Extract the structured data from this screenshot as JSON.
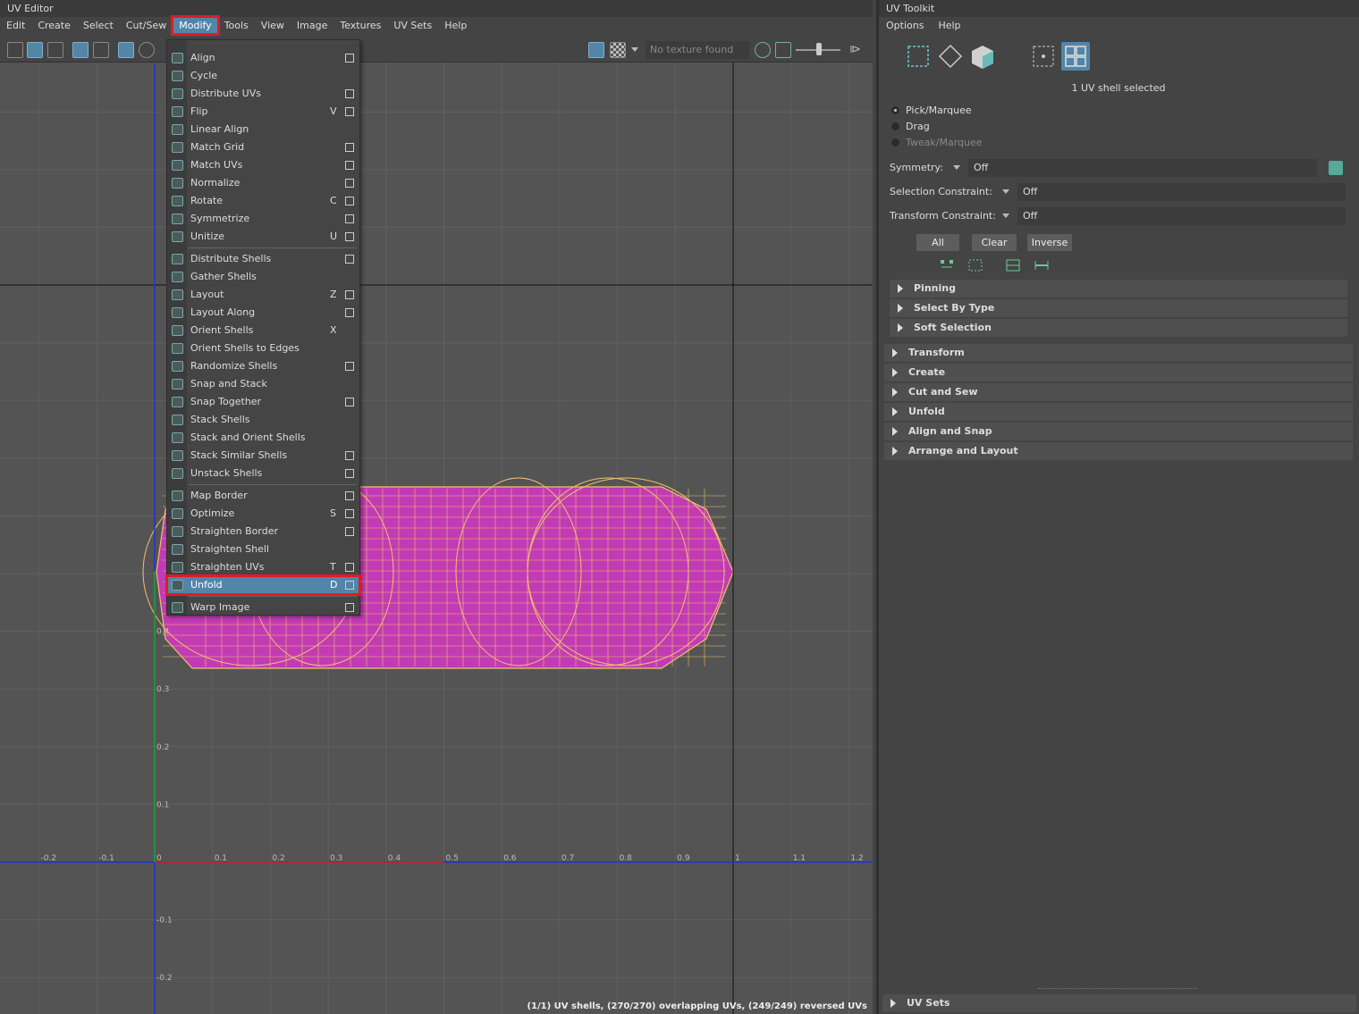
{
  "editor": {
    "title": "UV Editor",
    "menus": [
      "Edit",
      "Create",
      "Select",
      "Cut/Sew",
      "Modify",
      "Tools",
      "View",
      "Image",
      "Textures",
      "UV Sets",
      "Help"
    ],
    "active_menu": "Modify",
    "texture_field": "No texture found",
    "status": "(1/1) UV shells, (270/270) overlapping UVs, (249/249) reversed UVs",
    "axis_labels": {
      "x": [
        "-0.2",
        "-0.1",
        "0",
        "0.1",
        "0.2",
        "0.3",
        "0.4",
        "0.5",
        "0.6",
        "0.7",
        "0.8",
        "0.9",
        "1",
        "1.1",
        "1.2"
      ],
      "y": [
        "0.1",
        "0.2",
        "0.3",
        "0.4",
        "-0.1",
        "-0.2"
      ]
    },
    "colors": {
      "accent": "#5285a6",
      "highlight_border": "#e01b24",
      "uv_fill": "#d637c6",
      "uv_wire": "#f0c070"
    }
  },
  "dropdown": {
    "items": [
      {
        "label": "Align",
        "key": "",
        "option": true
      },
      {
        "label": "Cycle",
        "key": "",
        "option": false
      },
      {
        "label": "Distribute UVs",
        "key": "",
        "option": true
      },
      {
        "label": "Flip",
        "key": "V",
        "option": true
      },
      {
        "label": "Linear Align",
        "key": "",
        "option": false
      },
      {
        "label": "Match Grid",
        "key": "",
        "option": true
      },
      {
        "label": "Match UVs",
        "key": "",
        "option": true
      },
      {
        "label": "Normalize",
        "key": "",
        "option": true
      },
      {
        "label": "Rotate",
        "key": "C",
        "option": true
      },
      {
        "label": "Symmetrize",
        "key": "",
        "option": true
      },
      {
        "label": "Unitize",
        "key": "U",
        "option": true
      },
      {
        "label": "Distribute Shells",
        "key": "",
        "option": true
      },
      {
        "label": "Gather Shells",
        "key": "",
        "option": false
      },
      {
        "label": "Layout",
        "key": "Z",
        "option": true
      },
      {
        "label": "Layout Along",
        "key": "",
        "option": true
      },
      {
        "label": "Orient Shells",
        "key": "X",
        "option": false
      },
      {
        "label": "Orient Shells to Edges",
        "key": "",
        "option": false
      },
      {
        "label": "Randomize Shells",
        "key": "",
        "option": true
      },
      {
        "label": "Snap and Stack",
        "key": "",
        "option": false
      },
      {
        "label": "Snap Together",
        "key": "",
        "option": true
      },
      {
        "label": "Stack Shells",
        "key": "",
        "option": false
      },
      {
        "label": "Stack and Orient Shells",
        "key": "",
        "option": false
      },
      {
        "label": "Stack Similar Shells",
        "key": "",
        "option": true
      },
      {
        "label": "Unstack Shells",
        "key": "",
        "option": true
      },
      {
        "label": "Map Border",
        "key": "",
        "option": true
      },
      {
        "label": "Optimize",
        "key": "S",
        "option": true
      },
      {
        "label": "Straighten Border",
        "key": "",
        "option": true
      },
      {
        "label": "Straighten Shell",
        "key": "",
        "option": false
      },
      {
        "label": "Straighten UVs",
        "key": "T",
        "option": true
      },
      {
        "label": "Unfold",
        "key": "D",
        "option": true
      },
      {
        "label": "Warp Image",
        "key": "",
        "option": true
      }
    ]
  },
  "toolkit": {
    "title": "UV Toolkit",
    "menus": [
      "Options",
      "Help"
    ],
    "selection_info": "1 UV shell selected",
    "modes": [
      {
        "label": "Pick/Marquee",
        "selected": true,
        "enabled": true
      },
      {
        "label": "Drag",
        "selected": false,
        "enabled": true
      },
      {
        "label": "Tweak/Marquee",
        "selected": false,
        "enabled": false
      }
    ],
    "symmetry": {
      "label": "Symmetry:",
      "value": "Off"
    },
    "selection_constraint": {
      "label": "Selection Constraint:",
      "value": "Off"
    },
    "transform_constraint": {
      "label": "Transform Constraint:",
      "value": "Off"
    },
    "buttons": [
      "All",
      "Clear",
      "Inverse"
    ],
    "sub_sections": [
      "Pinning",
      "Select By Type",
      "Soft Selection"
    ],
    "sections": [
      "Transform",
      "Create",
      "Cut and Sew",
      "Unfold",
      "Align and Snap",
      "Arrange and Layout"
    ],
    "bottom_section": "UV Sets"
  }
}
